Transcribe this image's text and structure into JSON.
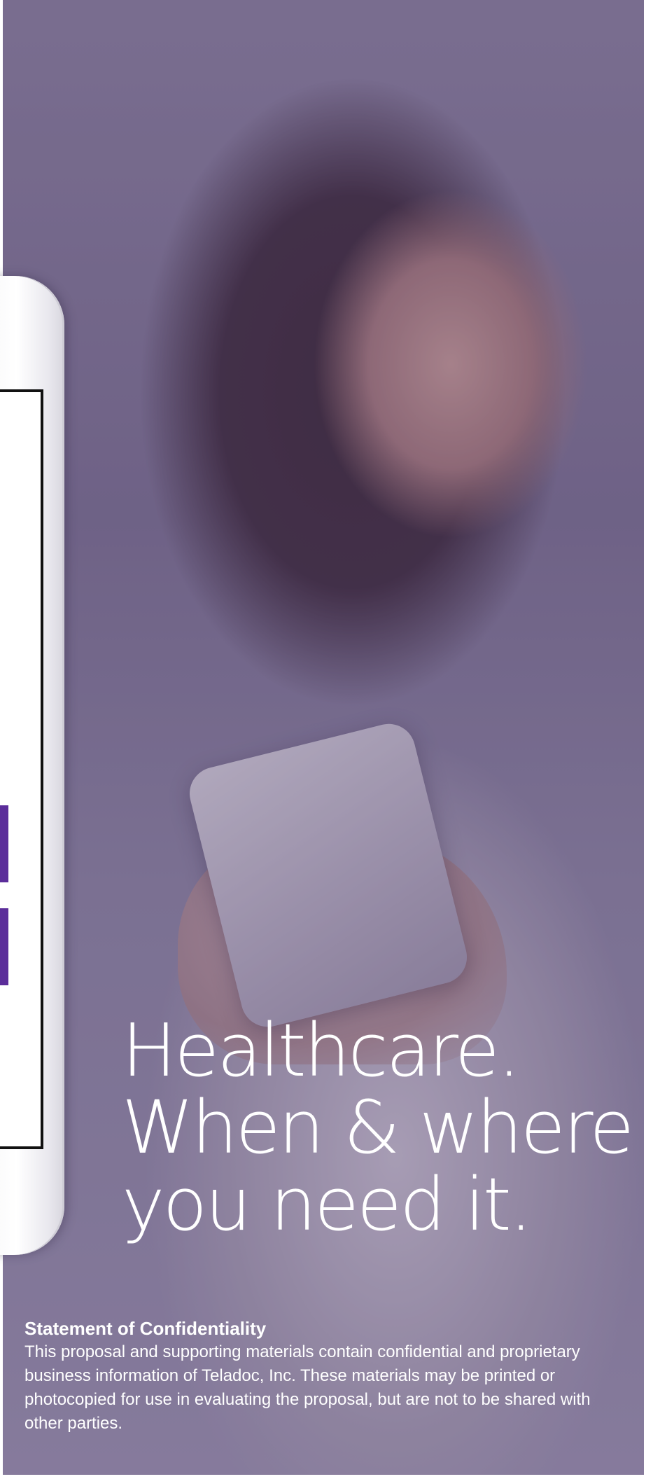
{
  "headline": {
    "line1": "Healthcare.",
    "line2": "When & where",
    "line3": "you need it."
  },
  "confidentiality": {
    "heading": "Statement of Confidentiality",
    "body": "This proposal and supporting materials contain confidential and proprietary business information of Teladoc, Inc. These  materials may be printed or photocopied for use in evaluating the proposal, but are not to be shared with other parties."
  },
  "colors": {
    "overlay": "#50426e",
    "device_screen_accent": "#5b2d9a",
    "text": "#ffffff"
  }
}
